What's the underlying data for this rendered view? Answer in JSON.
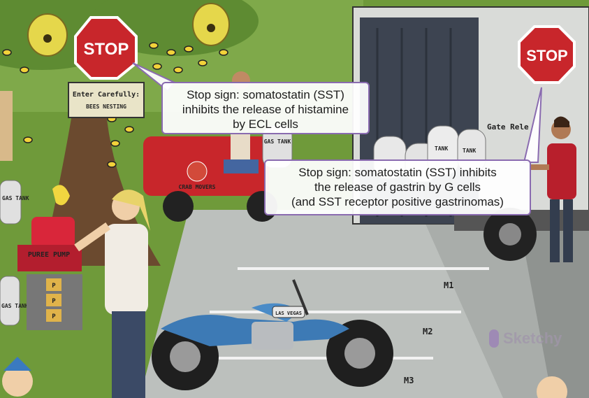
{
  "callouts": [
    {
      "lines": [
        "Stop sign: somatostatin (SST)",
        "inhibits the release of histamine",
        "by ECL cells"
      ]
    },
    {
      "lines": [
        "Stop sign: somatostatin (SST) inhibits",
        "the release of gastrin by G cells",
        "(and SST receptor positive gastrinomas)"
      ]
    }
  ],
  "signs": {
    "stop_left": "STOP",
    "stop_right": "STOP",
    "tree_sign_line1": "Enter Carefully:",
    "tree_sign_line2": "BEES NESTING",
    "gas_tank": "GAS TANK",
    "gas_left_top": "GAS TANK",
    "gas_left_bottom": "GAS TANK",
    "puree_pump": "PUREE PUMP",
    "truck_door": "Gate Rele",
    "crab_movers": "CRAB MOVERS",
    "tanks_on_truck": "TANK",
    "motorcycle_badge": "LAS VEGAS",
    "parking_numbers": [
      "M1",
      "M2",
      "M3"
    ],
    "pump_cans": [
      "P",
      "P",
      "P"
    ]
  },
  "watermark": "Sketchy",
  "colors": {
    "callout_border": "#8a6bb0",
    "stop_red": "#c8262b",
    "grass": "#6f9a3a",
    "road": "#bcc0bd"
  }
}
